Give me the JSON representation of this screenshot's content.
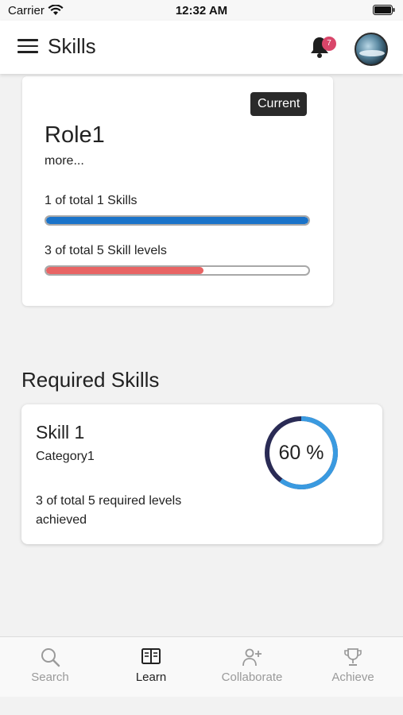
{
  "status_bar": {
    "carrier": "Carrier",
    "time": "12:32 AM"
  },
  "app_bar": {
    "title": "Skills",
    "notification_count": "7"
  },
  "role_card": {
    "badge": "Current",
    "title": "Role1",
    "more_link": "more...",
    "skills_progress": {
      "label": "1 of total 1 Skills",
      "fraction": 1.0,
      "color": "#1a73c9"
    },
    "levels_progress": {
      "label": "3 of total 5 Skill levels",
      "fraction": 0.6,
      "color": "#e86464"
    }
  },
  "required_skills": {
    "title": "Required Skills",
    "items": [
      {
        "name": "Skill 1",
        "category": "Category1",
        "levels_text": "3 of total 5 required levels achieved",
        "percent_label": "60 %",
        "percent": 60,
        "ring_color": "#3a9ae0",
        "ring_track_color": "#2a2b55"
      }
    ]
  },
  "bottom_nav": {
    "items": [
      {
        "label": "Search",
        "icon": "search-icon",
        "active": false
      },
      {
        "label": "Learn",
        "icon": "book-icon",
        "active": true
      },
      {
        "label": "Collaborate",
        "icon": "add-person-icon",
        "active": false
      },
      {
        "label": "Achieve",
        "icon": "trophy-icon",
        "active": false
      }
    ]
  }
}
